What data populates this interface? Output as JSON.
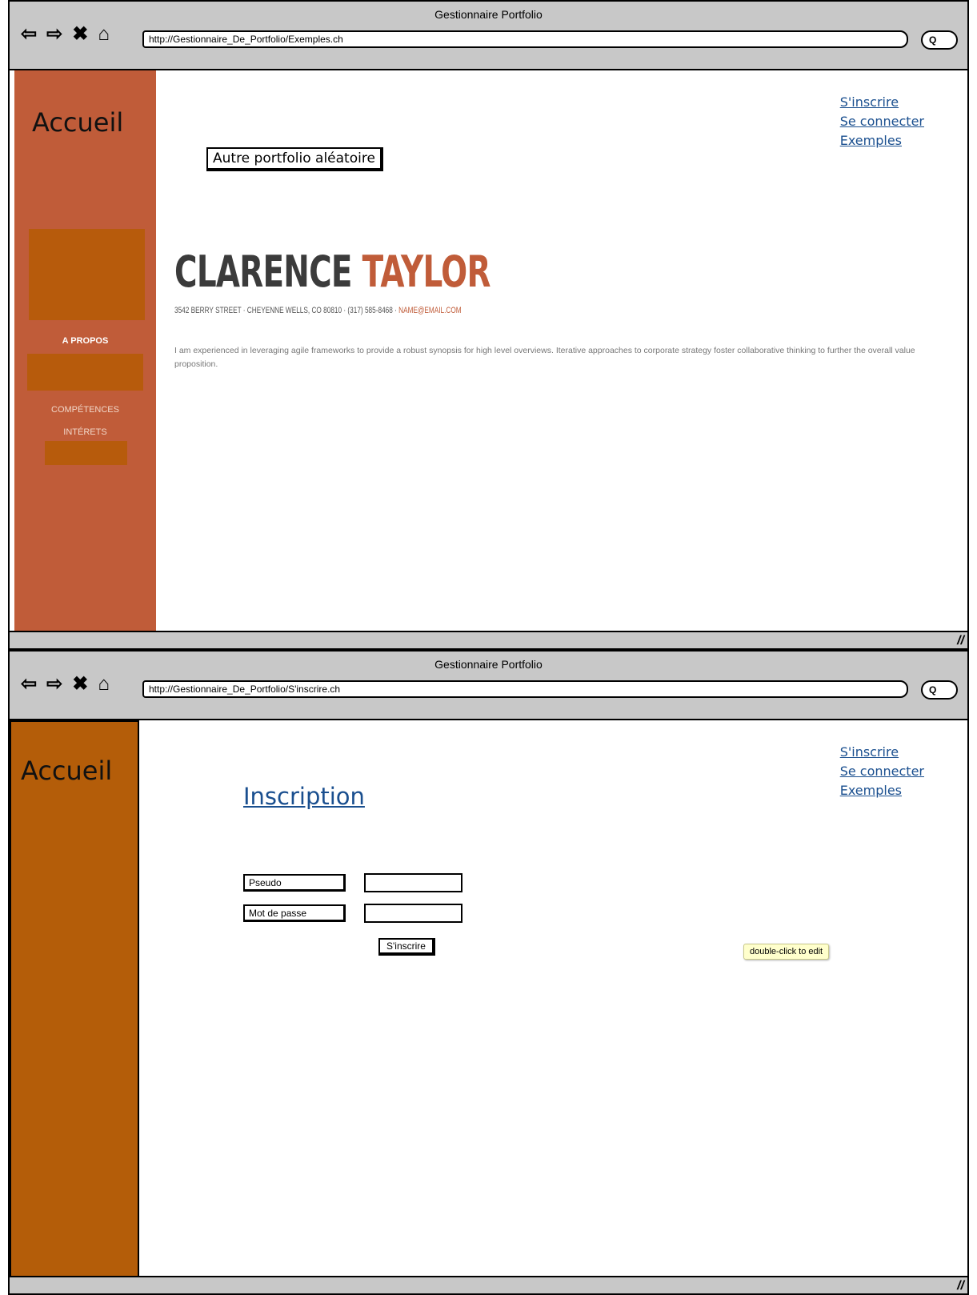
{
  "windows": [
    {
      "title": "Gestionnaire Portfolio",
      "url": "http://Gestionnaire_De_Portfolio/Exemples.ch",
      "sidebar": {
        "title": "Accueil",
        "items": [
          "A PROPOS",
          "COMPÉTENCES",
          "INTÉRETS"
        ]
      },
      "links": [
        "S'inscrire",
        "Se connecter",
        "Exemples"
      ],
      "random_button": "Autre portfolio aléatoire",
      "profile": {
        "first_name": "CLARENCE",
        "last_name": "TAYLOR",
        "contact": "3542 BERRY STREET · CHEYENNE WELLS, CO 80810 · (317) 585-8468 · ",
        "email": "NAME@EMAIL.COM",
        "bio": "I am experienced in leveraging agile frameworks to provide a robust synopsis for high level overviews. Iterative approaches to corporate strategy foster collaborative thinking to further the overall value proposition."
      }
    },
    {
      "title": "Gestionnaire Portfolio",
      "url": "http://Gestionnaire_De_Portfolio/S'inscrire.ch",
      "sidebar": {
        "title": "Accueil"
      },
      "links": [
        "S'inscrire",
        "Se connecter",
        "Exemples"
      ],
      "form": {
        "heading": "Inscription",
        "username_label": "Pseudo",
        "username_value": "",
        "password_label": "Mot de passe",
        "password_value": "",
        "submit_label": "S'inscrire"
      },
      "tooltip": "double-click to edit"
    }
  ],
  "nav_icons": [
    "back-arrow-icon",
    "forward-arrow-icon",
    "stop-icon",
    "home-icon",
    "search-icon"
  ],
  "colors": {
    "sidebar1": "#c05c39",
    "sidebar2": "#b45d09",
    "link": "#1a4f8f",
    "accent": "#c05c39"
  }
}
